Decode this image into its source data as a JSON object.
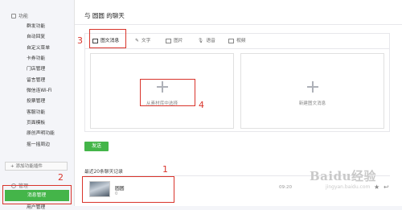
{
  "sidebar": {
    "section_title": "功能",
    "items": [
      {
        "label": "群发功能"
      },
      {
        "label": "自动回复"
      },
      {
        "label": "自定义菜单"
      },
      {
        "label": "卡券功能"
      },
      {
        "label": "门店管理"
      },
      {
        "label": "留言管理"
      },
      {
        "label": "微信连Wi-Fi"
      },
      {
        "label": "投票管理"
      },
      {
        "label": "客服功能"
      },
      {
        "label": "页面模板"
      },
      {
        "label": "原创声明功能"
      },
      {
        "label": "摇一摇周边"
      }
    ],
    "add_plugin": "+ 添加功能插件",
    "manage_section": "管理",
    "active_item": "消息管理",
    "below_item": "用户管理"
  },
  "main": {
    "title": "与 圆圆 的聊天",
    "tabs": [
      {
        "label": "图文消息",
        "icon": "news-icon"
      },
      {
        "label": "文字",
        "icon": "pen-icon"
      },
      {
        "label": "图片",
        "icon": "image-icon"
      },
      {
        "label": "语音",
        "icon": "mic-icon"
      },
      {
        "label": "视频",
        "icon": "video-icon"
      }
    ],
    "cards": [
      {
        "label": "从素材库中选择"
      },
      {
        "label": "新建图文消息"
      }
    ],
    "send_label": "发送",
    "recent_label": "最近20条聊天记录",
    "message": {
      "name": "圆圆",
      "sub": "0",
      "time": "09:20"
    }
  },
  "annotations": {
    "n1": "1",
    "n2": "2",
    "n3": "3",
    "n4": "4"
  },
  "watermark": {
    "text": "Baidu经验",
    "sub": "jingyan.baidu.com"
  },
  "colors": {
    "accent_green": "#44b549",
    "annotation_red": "#d9342b"
  }
}
